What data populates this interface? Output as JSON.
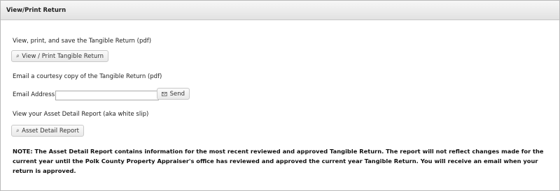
{
  "header": {
    "title": "View/Print Return"
  },
  "sections": {
    "view_text": "View, print, and save the Tangible Return (pdf)",
    "view_button": "View / Print Tangible Return",
    "email_text": "Email a courtesy copy of the Tangible Return (pdf)",
    "email_label": "Email Address:",
    "email_value": "",
    "send_button": "Send",
    "asset_text": "View your Asset Detail Report (aka white slip)",
    "asset_button": "Asset Detail Report"
  },
  "note": "NOTE: The Asset Detail Report contains information for the most recent reviewed and approved Tangible Return. The report will not reflect changes made for the current year until the Polk County Property Appraiser's office has reviewed and approved the current year Tangible Return. You will receive an email when your return is approved.",
  "icons": {
    "view": "search-icon",
    "send": "envelope-icon",
    "asset": "search-icon"
  }
}
